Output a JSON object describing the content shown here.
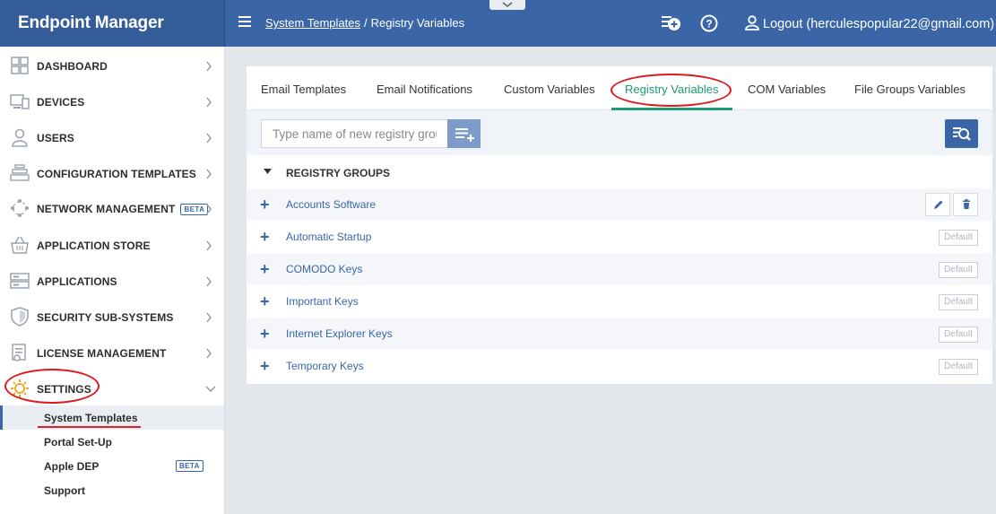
{
  "app": {
    "brand": "Endpoint Manager",
    "breadcrumb": [
      "System Templates",
      "Registry Variables"
    ],
    "breadcrumb_sep": "/",
    "logout_label": "Logout (herculespopular22@gmail.com)",
    "icons": [
      "add-ticket-icon",
      "help-icon",
      "user-icon",
      "chevron-down-icon",
      "hamburger-icon"
    ]
  },
  "sidebar": {
    "items": [
      {
        "label": "DASHBOARD",
        "icon": "dashboard-icon"
      },
      {
        "label": "DEVICES",
        "icon": "devices-icon"
      },
      {
        "label": "USERS",
        "icon": "users-icon"
      },
      {
        "label": "CONFIGURATION TEMPLATES",
        "icon": "config-templates-icon"
      },
      {
        "label": "NETWORK MANAGEMENT",
        "icon": "network-icon",
        "badge": "BETA"
      },
      {
        "label": "APPLICATION STORE",
        "icon": "store-icon"
      },
      {
        "label": "APPLICATIONS",
        "icon": "applications-icon"
      },
      {
        "label": "SECURITY SUB-SYSTEMS",
        "icon": "shield-icon"
      },
      {
        "label": "LICENSE MANAGEMENT",
        "icon": "license-icon"
      },
      {
        "label": "SETTINGS",
        "icon": "gear-icon",
        "expanded": true
      }
    ],
    "settings_children": [
      {
        "label": "System Templates",
        "active": true
      },
      {
        "label": "Portal Set-Up"
      },
      {
        "label": "Apple DEP",
        "badge": "BETA"
      },
      {
        "label": "Support"
      }
    ]
  },
  "tabs": [
    {
      "label": "Email Templates"
    },
    {
      "label": "Email Notifications"
    },
    {
      "label": "Custom Variables"
    },
    {
      "label": "Registry Variables",
      "active": true
    },
    {
      "label": "COM Variables"
    },
    {
      "label": "File Groups Variables"
    }
  ],
  "search": {
    "placeholder": "Type name of new registry group",
    "value": ""
  },
  "group_header": "REGISTRY GROUPS",
  "rows": [
    {
      "name": "Accounts Software",
      "default": false
    },
    {
      "name": "Automatic Startup",
      "default": true
    },
    {
      "name": "COMODO Keys",
      "default": true
    },
    {
      "name": "Important Keys",
      "default": true
    },
    {
      "name": "Internet Explorer Keys",
      "default": true
    },
    {
      "name": "Temporary Keys",
      "default": true
    }
  ],
  "default_label": "Default",
  "colors": {
    "primary": "#3a66a7",
    "accent_green": "#1d9c73",
    "annotation_red": "#e0161d"
  }
}
